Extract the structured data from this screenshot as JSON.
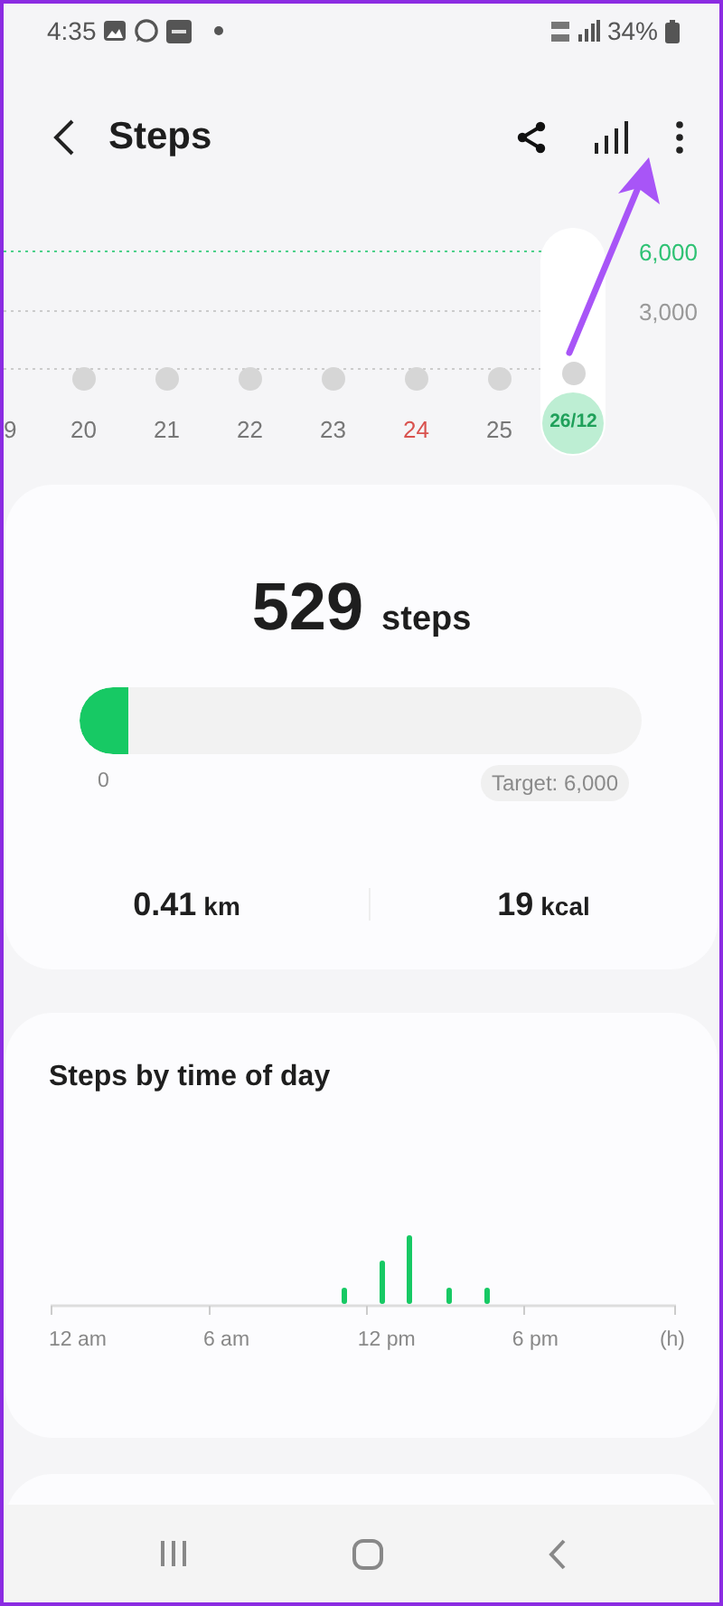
{
  "status_bar": {
    "time": "4:35",
    "battery": "34%"
  },
  "header": {
    "title": "Steps"
  },
  "week_strip": {
    "goal_label": "6,000",
    "mid_label": "3,000",
    "days": [
      {
        "label": "9",
        "kind": "weekday",
        "selected": false
      },
      {
        "label": "20",
        "kind": "weekday",
        "selected": false
      },
      {
        "label": "21",
        "kind": "weekday",
        "selected": false
      },
      {
        "label": "22",
        "kind": "weekday",
        "selected": false
      },
      {
        "label": "23",
        "kind": "weekday",
        "selected": false
      },
      {
        "label": "24",
        "kind": "sunday",
        "selected": false
      },
      {
        "label": "25",
        "kind": "weekday",
        "selected": false
      },
      {
        "label": "26/12",
        "kind": "weekday",
        "selected": true
      }
    ]
  },
  "summary": {
    "count": "529",
    "unit": "steps",
    "level": 0.088,
    "start_label": "0",
    "target": "Target: 6,000",
    "stats": [
      {
        "value": "0.41",
        "unit": "km"
      },
      {
        "value": "19",
        "unit": "kcal"
      }
    ]
  },
  "time_of_day": {
    "title": "Steps by time of day",
    "axis_labels": [
      "12 am",
      "6 am",
      "12 pm",
      "6 pm",
      "(h)"
    ]
  }
}
